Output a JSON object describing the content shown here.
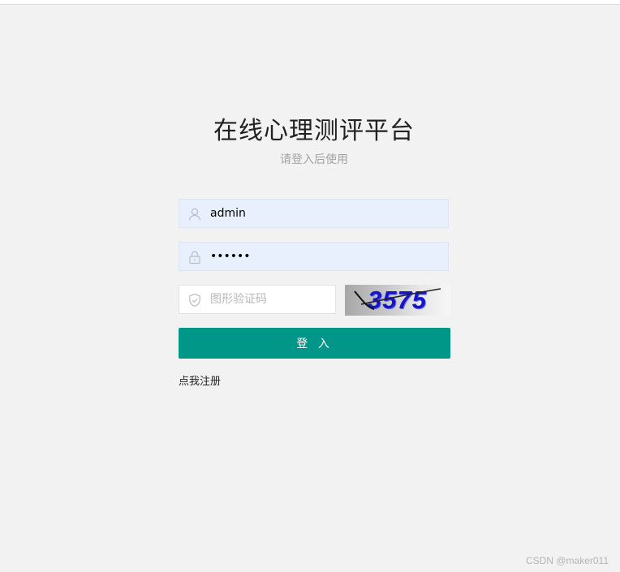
{
  "header": {
    "title": "在线心理测评平台",
    "subtitle": "请登入后使用"
  },
  "form": {
    "username": {
      "value": "admin",
      "icon": "user-icon"
    },
    "password": {
      "value": "123456",
      "icon": "lock-icon"
    },
    "captcha": {
      "placeholder": "图形验证码",
      "value": "",
      "icon": "shield-check-icon",
      "image_text": "3575"
    },
    "login_label": "登 入",
    "register_label": "点我注册"
  },
  "watermark": "CSDN @maker011",
  "colors": {
    "primary": "#009688",
    "background": "#f2f2f2",
    "autofill": "#e8f0fe",
    "captcha_digits": "#1515c8"
  }
}
